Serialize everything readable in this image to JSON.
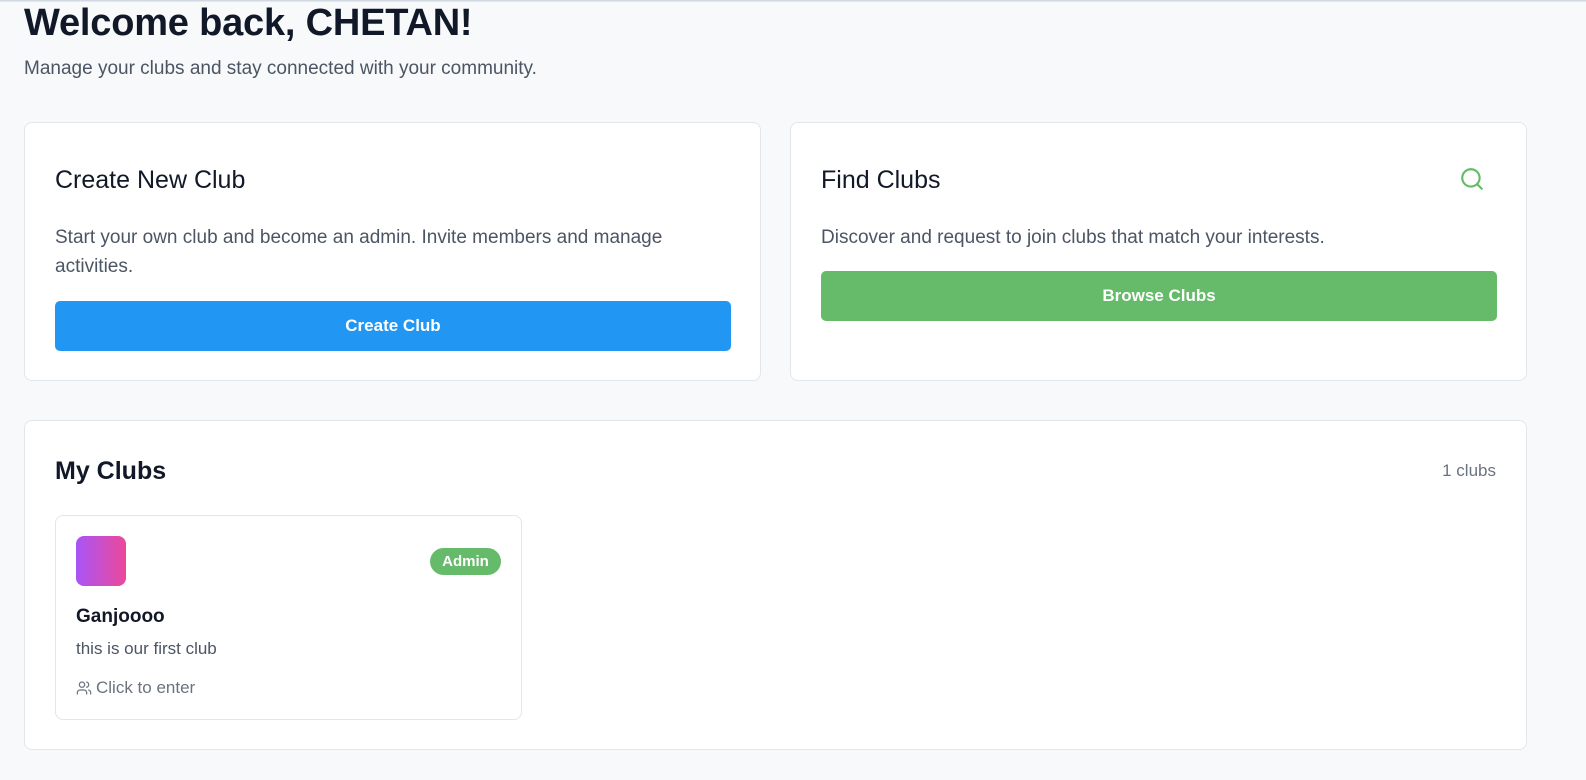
{
  "header": {
    "welcome": "Welcome back, CHETAN!",
    "subtitle": "Manage your clubs and stay connected with your community."
  },
  "create_card": {
    "title": "Create New Club",
    "description": "Start your own club and become an admin. Invite members and manage activities.",
    "button_label": "Create Club",
    "button_color": "#2196f3"
  },
  "find_card": {
    "title": "Find Clubs",
    "description": "Discover and request to join clubs that match your interests.",
    "button_label": "Browse Clubs",
    "button_color": "#66bb6a",
    "icon": "search-icon"
  },
  "my_clubs": {
    "title": "My Clubs",
    "count_label": "1 clubs",
    "clubs": [
      {
        "name": "Ganjoooo",
        "description": "this is our first club",
        "role_badge": "Admin",
        "enter_label": "Click to enter",
        "icon": "users-icon"
      }
    ]
  }
}
